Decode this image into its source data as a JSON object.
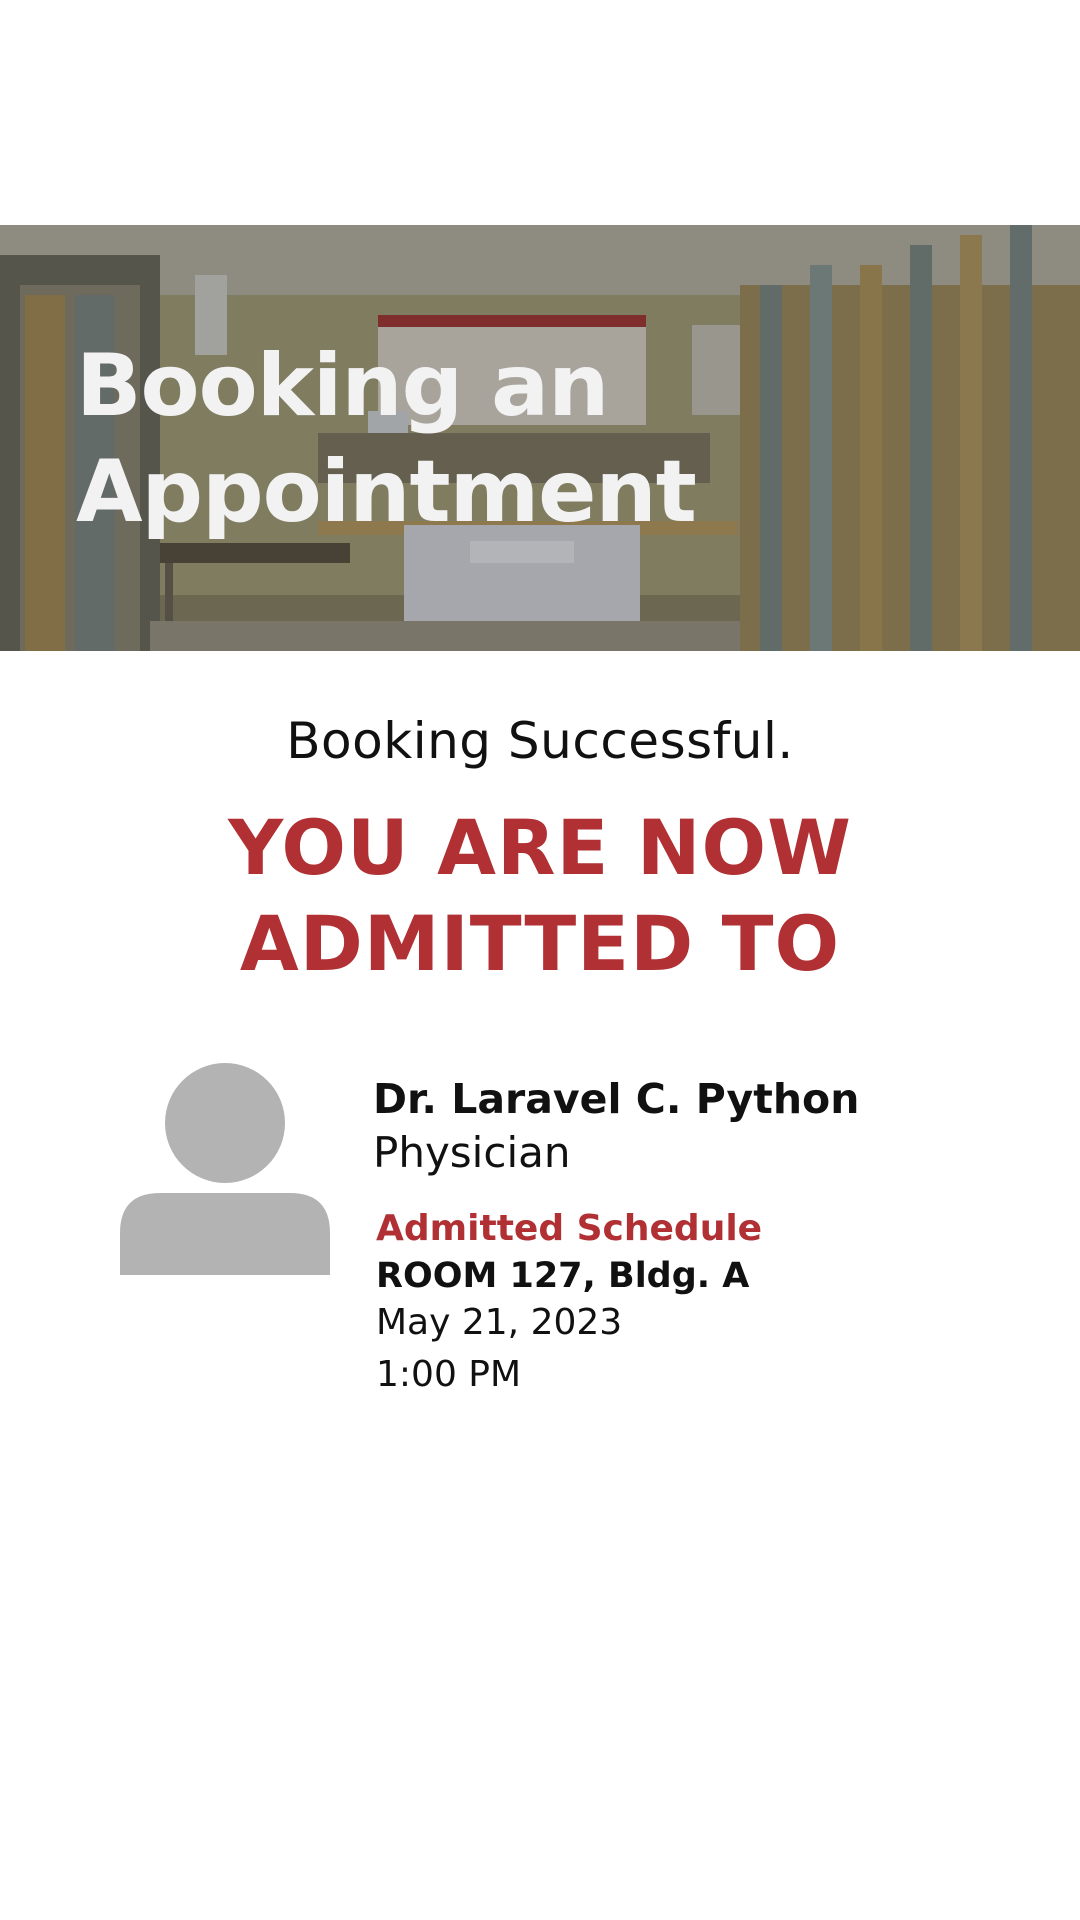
{
  "hero": {
    "title": "Booking an\nAppointment"
  },
  "confirmation": {
    "status": "Booking Successful.",
    "heading": "YOU ARE NOW\nADMITTED TO"
  },
  "doctor": {
    "name": "Dr. Laravel C. Python",
    "role": "Physician"
  },
  "schedule": {
    "label": "Admitted Schedule",
    "room": "ROOM 127, Bldg. A",
    "date": "May 21, 2023",
    "time": "1:00 PM"
  },
  "colors": {
    "accent": "#b03034",
    "avatar": "#b3b3b3"
  }
}
